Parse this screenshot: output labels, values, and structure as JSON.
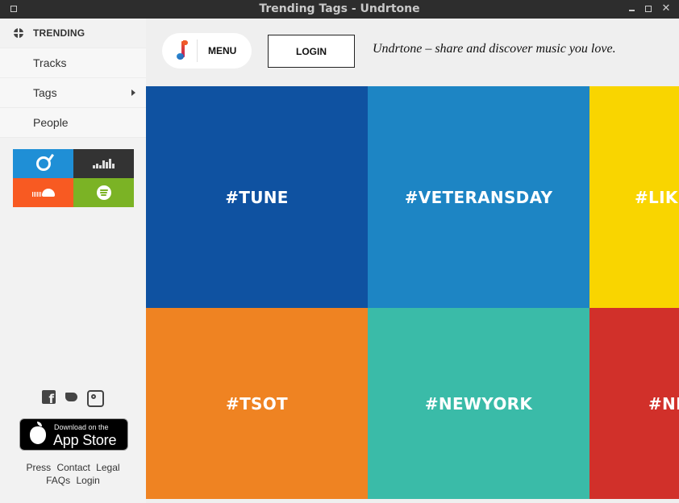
{
  "window": {
    "title": "Trending Tags - Undrtone"
  },
  "sidebar": {
    "heading": "TRENDING",
    "items": [
      {
        "label": "Tracks"
      },
      {
        "label": "Tags",
        "has_submenu": true
      },
      {
        "label": "People"
      }
    ],
    "services": [
      {
        "name": "rdio",
        "icon": "rdio-icon",
        "color": "#1f8fd6"
      },
      {
        "name": "deezer",
        "icon": "deezer-icon",
        "color": "#333333"
      },
      {
        "name": "soundcloud",
        "icon": "soundcloud-icon",
        "color": "#f85a22"
      },
      {
        "name": "spotify",
        "icon": "spotify-icon",
        "color": "#7bb325"
      }
    ],
    "social": [
      "facebook-icon",
      "twitter-icon",
      "instagram-icon"
    ],
    "appstore": {
      "small": "Download on the",
      "big": "App Store"
    },
    "footer_links_row1": [
      "Press",
      "Contact",
      "Legal"
    ],
    "footer_links_row2": [
      "FAQs",
      "Login"
    ]
  },
  "header": {
    "menu_label": "MENU",
    "login_label": "LOGIN",
    "tagline": "Undrtone – share and discover music you love."
  },
  "tags": [
    {
      "label": "#TUNE",
      "color": "#0f52a1"
    },
    {
      "label": "#VETERANSDAY",
      "color": "#1d85c4"
    },
    {
      "label": "#LIKE",
      "color": "#f9d500"
    },
    {
      "label": "#TSOT",
      "color": "#ef8322"
    },
    {
      "label": "#NEWYORK",
      "color": "#3abba8"
    },
    {
      "label": "#NE",
      "color": "#d1302a"
    }
  ]
}
